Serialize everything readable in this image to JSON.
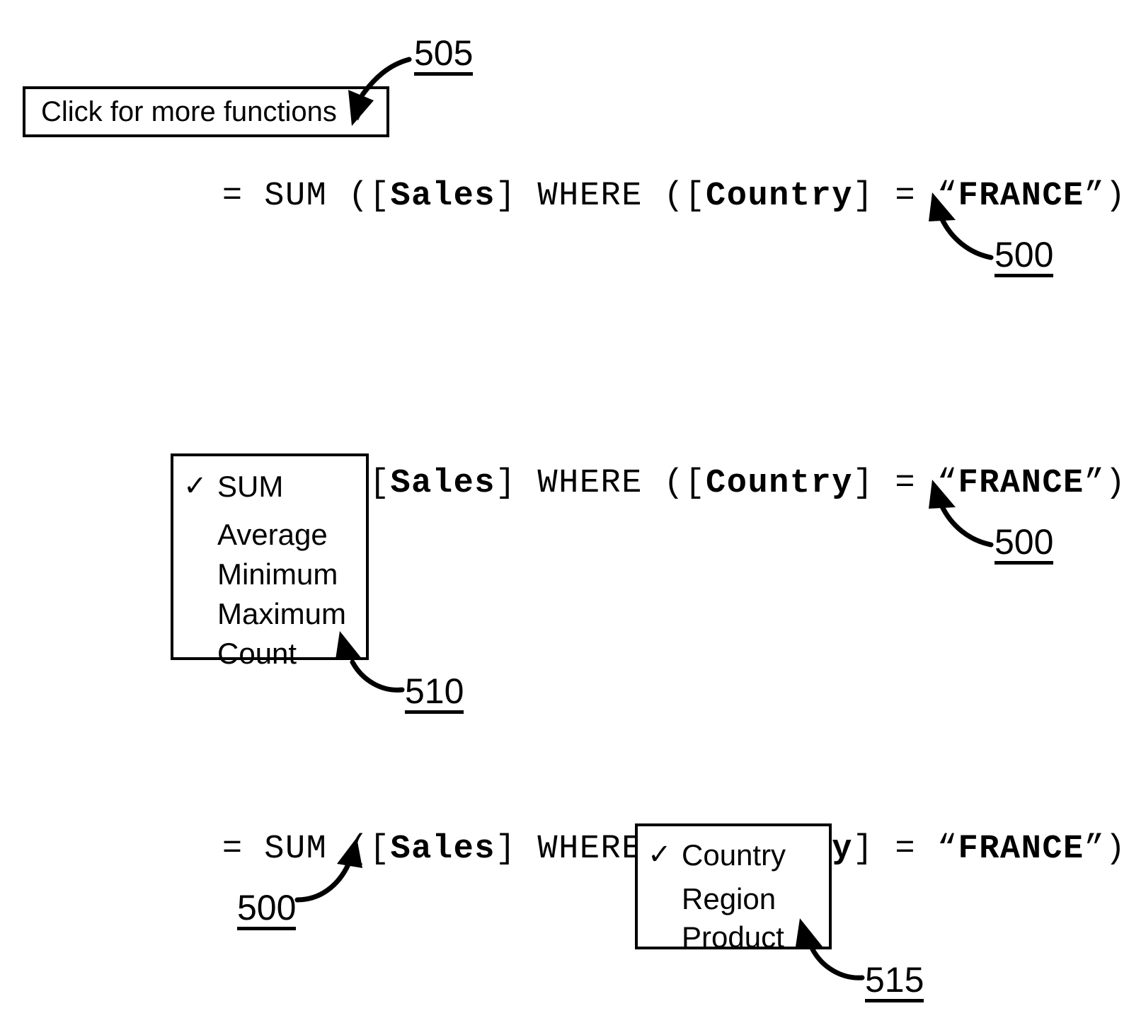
{
  "figure": {
    "panels": [
      {
        "id": "panel-top",
        "formula": {
          "segments": [
            {
              "text": "= SUM ([",
              "bold": false
            },
            {
              "text": "Sales",
              "bold": true
            },
            {
              "text": "] WHERE ([",
              "bold": false
            },
            {
              "text": "Country",
              "bold": true
            },
            {
              "text": "] = “",
              "bold": false
            },
            {
              "text": "FRANCE",
              "bold": true
            },
            {
              "text": "”))",
              "bold": false
            }
          ],
          "plain": "= SUM ([Sales] WHERE ([Country] = “FRANCE”))"
        },
        "tooltip": {
          "label": "Click for more functions",
          "caret_icon": "▼"
        },
        "refs": [
          {
            "label": "505",
            "target": "tooltip-caret"
          },
          {
            "label": "500",
            "target": "formula-bar"
          }
        ]
      },
      {
        "id": "panel-middle",
        "formula": {
          "segments": [
            {
              "text": "= SUM ([",
              "bold": false
            },
            {
              "text": "Sales",
              "bold": true
            },
            {
              "text": "] WHERE ([",
              "bold": false
            },
            {
              "text": "Country",
              "bold": true
            },
            {
              "text": "] = “",
              "bold": false
            },
            {
              "text": "FRANCE",
              "bold": true
            },
            {
              "text": "”))",
              "bold": false
            }
          ],
          "plain": "= SUM ([Sales] WHERE ([Country] = “FRANCE”))"
        },
        "menu": {
          "name": "function-menu",
          "check_icon": "✓",
          "items": [
            {
              "label": "SUM",
              "checked": true
            },
            {
              "label": "Average",
              "checked": false
            },
            {
              "label": "Minimum",
              "checked": false
            },
            {
              "label": "Maximum",
              "checked": false
            },
            {
              "label": "Count",
              "checked": false
            }
          ]
        },
        "refs": [
          {
            "label": "510",
            "target": "function-menu"
          },
          {
            "label": "500",
            "target": "formula-bar"
          }
        ]
      },
      {
        "id": "panel-bottom",
        "formula": {
          "segments": [
            {
              "text": "= SUM ([",
              "bold": false
            },
            {
              "text": "Sales",
              "bold": true
            },
            {
              "text": "] WHERE ([",
              "bold": false
            },
            {
              "text": "Country",
              "bold": true
            },
            {
              "text": "] = “",
              "bold": false
            },
            {
              "text": "FRANCE",
              "bold": true
            },
            {
              "text": "”))",
              "bold": false
            }
          ],
          "plain": "= SUM ([Sales] WHERE ([Country] = “FRANCE”))"
        },
        "menu": {
          "name": "field-menu",
          "check_icon": "✓",
          "items": [
            {
              "label": "Country",
              "checked": true
            },
            {
              "label": "Region",
              "checked": false
            },
            {
              "label": "Product",
              "checked": false
            }
          ]
        },
        "refs": [
          {
            "label": "500",
            "target": "formula-bar"
          },
          {
            "label": "515",
            "target": "field-menu"
          }
        ]
      }
    ]
  },
  "colors": {
    "ink": "#000000",
    "paper": "#ffffff"
  }
}
